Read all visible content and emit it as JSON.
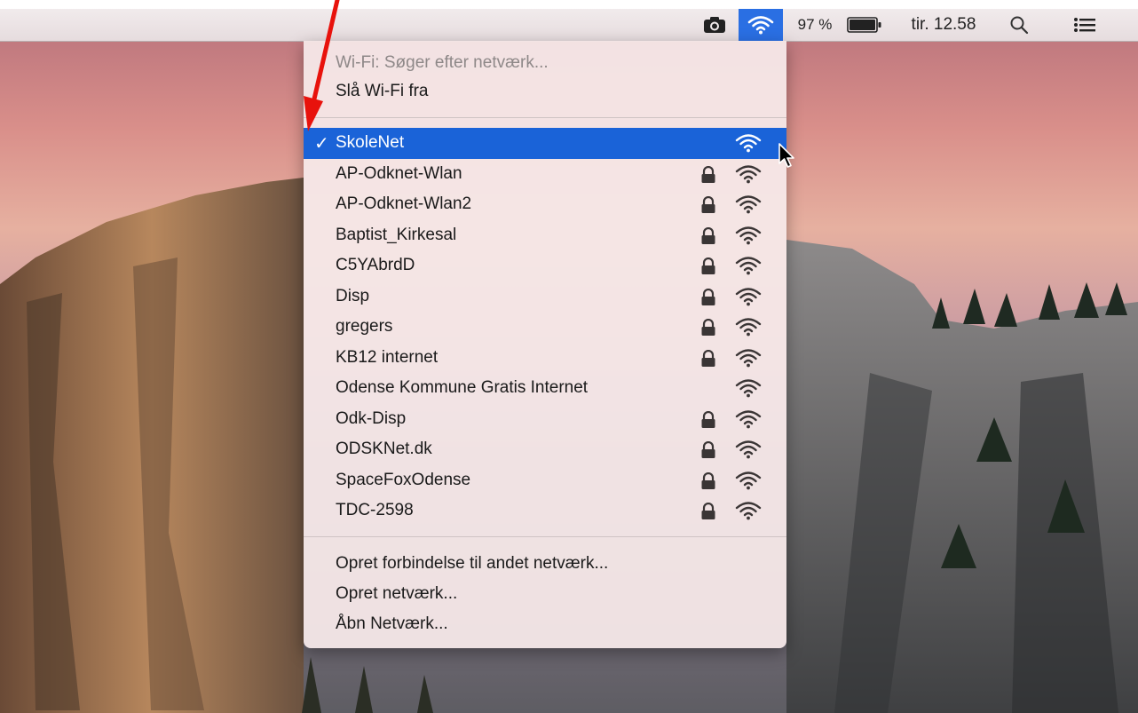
{
  "menubar": {
    "battery_percent": "97 %",
    "clock": "tir. 12.58",
    "icons": [
      "camera-icon",
      "wifi-icon",
      "battery-icon",
      "spotlight-search-icon",
      "notification-list-icon"
    ],
    "wifi_active_color": "#2a6fe3"
  },
  "wifi_menu": {
    "status": "Wi-Fi: Søger efter netværk...",
    "toggle_label": "Slå Wi-Fi fra",
    "selected_color": "#1a63d8",
    "networks": [
      {
        "name": "SkoleNet",
        "connected": true,
        "secured": false,
        "check": "✓"
      },
      {
        "name": "AP-Odknet-Wlan",
        "connected": false,
        "secured": true
      },
      {
        "name": "AP-Odknet-Wlan2",
        "connected": false,
        "secured": true
      },
      {
        "name": "Baptist_Kirkesal",
        "connected": false,
        "secured": true
      },
      {
        "name": "C5YAbrdD",
        "connected": false,
        "secured": true
      },
      {
        "name": "Disp",
        "connected": false,
        "secured": true
      },
      {
        "name": "gregers",
        "connected": false,
        "secured": true
      },
      {
        "name": "KB12 internet",
        "connected": false,
        "secured": true
      },
      {
        "name": "Odense Kommune Gratis Internet",
        "connected": false,
        "secured": false
      },
      {
        "name": "Odk-Disp",
        "connected": false,
        "secured": true
      },
      {
        "name": "ODSKNet.dk",
        "connected": false,
        "secured": true
      },
      {
        "name": "SpaceFoxOdense",
        "connected": false,
        "secured": true
      },
      {
        "name": "TDC-2598",
        "connected": false,
        "secured": true
      }
    ],
    "actions": [
      "Opret forbindelse til andet netværk...",
      "Opret netværk...",
      "Åbn Netværk..."
    ]
  },
  "annotation": {
    "arrow_color": "#e8120c"
  }
}
